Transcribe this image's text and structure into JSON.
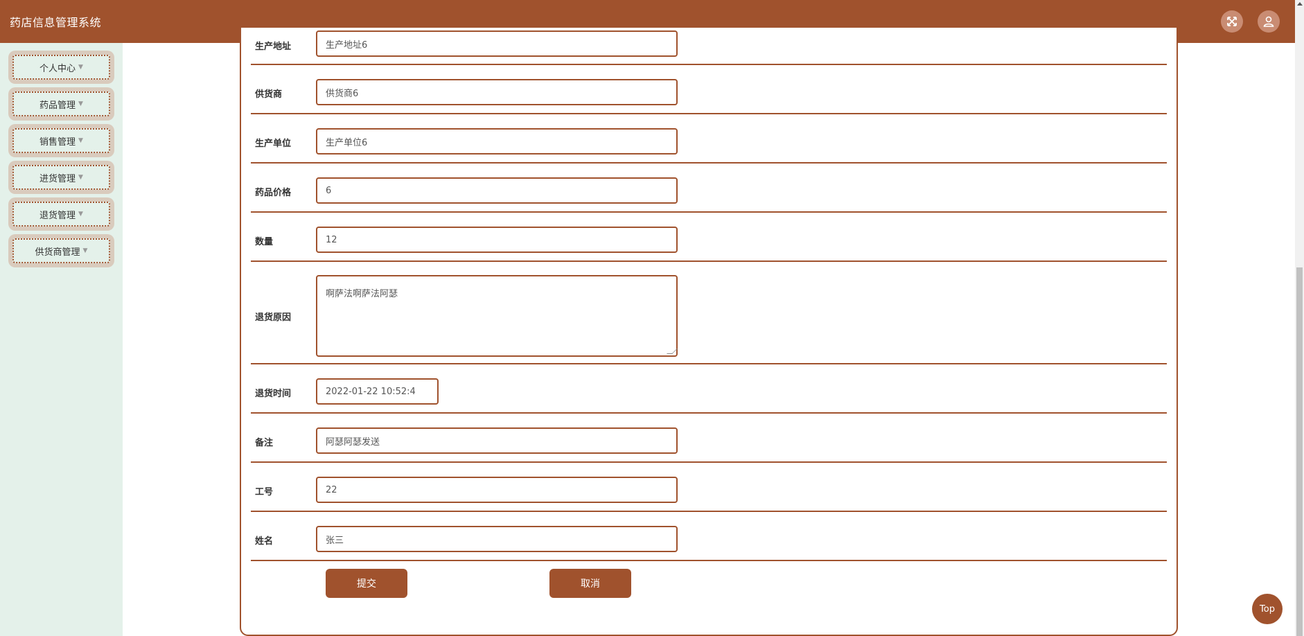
{
  "header": {
    "title": "药店信息管理系统",
    "icons": [
      "fullscreen-icon",
      "user-icon"
    ],
    "bg_color": "#a0522d"
  },
  "sidebar": {
    "items": [
      {
        "label": "个人中心"
      },
      {
        "label": "药品管理"
      },
      {
        "label": "销售管理"
      },
      {
        "label": "进货管理"
      },
      {
        "label": "退货管理"
      },
      {
        "label": "供货商管理"
      }
    ]
  },
  "form": {
    "rows": [
      {
        "label": "生产地址",
        "value": "生产地址6"
      },
      {
        "label": "供货商",
        "value": "供货商6"
      },
      {
        "label": "生产单位",
        "value": "生产单位6"
      },
      {
        "label": "药品价格",
        "value": "6"
      },
      {
        "label": "数量",
        "value": "12"
      },
      {
        "label": "退货原因",
        "value": "啊萨法啊萨法阿瑟"
      },
      {
        "label": "退货时间",
        "value": "2022-01-22 10:52:4"
      },
      {
        "label": "备注",
        "value": "阿瑟阿瑟发送"
      },
      {
        "label": "工号",
        "value": "22"
      },
      {
        "label": "姓名",
        "value": "张三"
      }
    ],
    "submit_label": "提交",
    "cancel_label": "取消"
  },
  "top_button": {
    "label": "Top"
  },
  "colors": {
    "accent": "#a0522d",
    "sidebar_bg": "#e4f1ea"
  }
}
